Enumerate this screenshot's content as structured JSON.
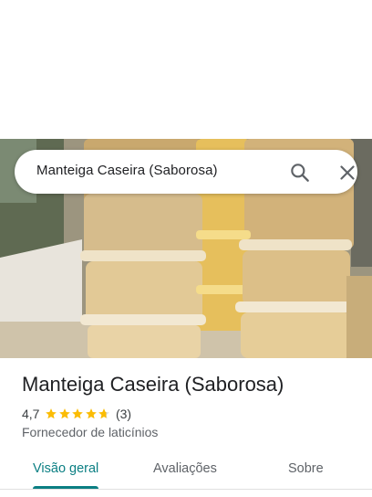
{
  "search": {
    "query": "Manteiga Caseira (Saborosa)"
  },
  "place": {
    "title": "Manteiga Caseira (Saborosa)",
    "rating_text": "4,7",
    "rating": 4.7,
    "reviews_text": "(3)",
    "category": "Fornecedor de laticínios"
  },
  "tabs": [
    {
      "label": "Visão geral",
      "active": true
    },
    {
      "label": "Avaliações",
      "active": false
    },
    {
      "label": "Sobre",
      "active": false
    }
  ],
  "colors": {
    "accent": "#0b7f83",
    "star": "#fbbc04",
    "star_empty": "#dadce0"
  },
  "icons": {
    "search": "search-icon",
    "close": "close-icon",
    "star": "star-icon"
  }
}
